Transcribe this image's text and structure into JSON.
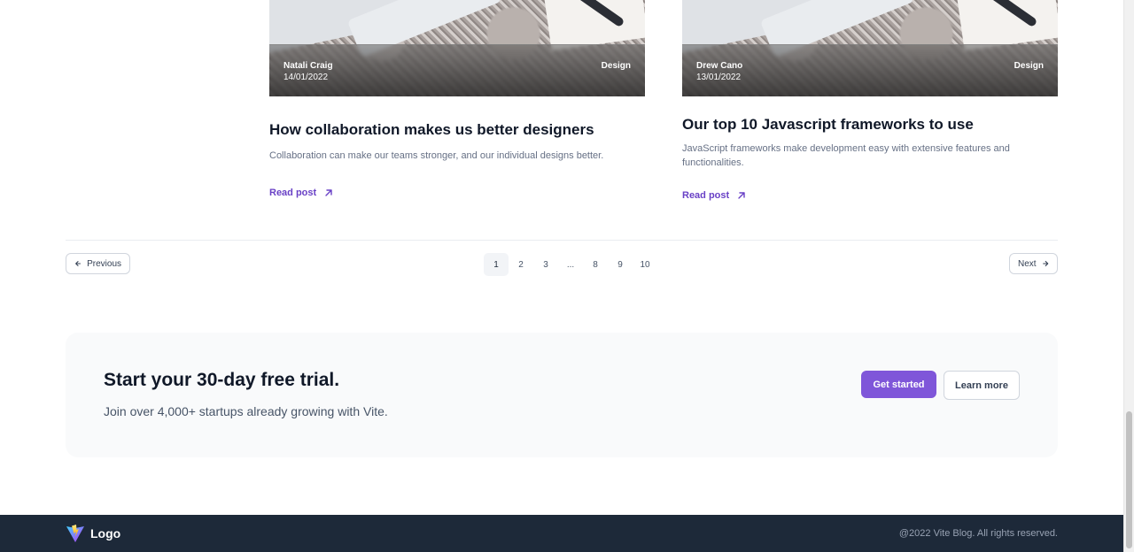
{
  "cards": [
    {
      "author": "Natali Craig",
      "date": "14/01/2022",
      "category": "Design",
      "title": "How collaboration makes us better designers",
      "excerpt": "Collaboration can make our teams stronger, and our individual designs better.",
      "read_label": "Read post"
    },
    {
      "author": "Drew Cano",
      "date": "13/01/2022",
      "category": "Design",
      "title": "Our top 10 Javascript frameworks to use",
      "excerpt": "JavaScript frameworks make development easy with extensive features and functionalities.",
      "read_label": "Read post"
    }
  ],
  "pagination": {
    "prev_label": "Previous",
    "next_label": "Next",
    "pages": [
      "1",
      "2",
      "3",
      "...",
      "8",
      "9",
      "10"
    ],
    "current": "1"
  },
  "cta": {
    "title": "Start your 30-day free trial.",
    "subtitle": "Join over 4,000+ startups already growing with Vite.",
    "primary_label": "Get started",
    "secondary_label": "Learn more"
  },
  "footer": {
    "logo_text": "Logo",
    "copyright": "@2022 Vite Blog. All rights reserved."
  },
  "colors": {
    "accent": "#7F56D9",
    "link": "#6941C6",
    "footer_bg": "#1D2939"
  }
}
